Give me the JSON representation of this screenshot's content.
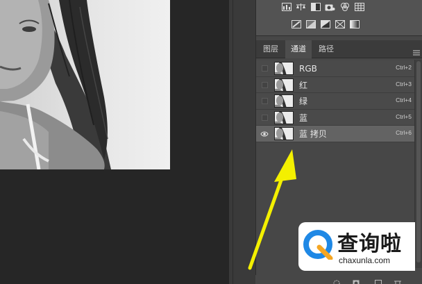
{
  "tabs": [
    {
      "label": "图层"
    },
    {
      "label": "通道"
    },
    {
      "label": "路径"
    }
  ],
  "active_tab": "通道",
  "channels": [
    {
      "name": "RGB",
      "shortcut": "Ctrl+2",
      "visible": false,
      "selected": false
    },
    {
      "name": "红",
      "shortcut": "Ctrl+3",
      "visible": false,
      "selected": false
    },
    {
      "name": "绿",
      "shortcut": "Ctrl+4",
      "visible": false,
      "selected": false
    },
    {
      "name": "蓝",
      "shortcut": "Ctrl+5",
      "visible": false,
      "selected": false
    },
    {
      "name": "蓝 拷贝",
      "shortcut": "Ctrl+6",
      "visible": true,
      "selected": true
    }
  ],
  "adjustment_icons_row1": [
    "levels-icon",
    "balance-icon",
    "black-white-icon",
    "photo-filter-icon",
    "channel-mixer-icon",
    "color-lookup-icon"
  ],
  "adjustment_icons_row2": [
    "invert-icon",
    "posterize-icon",
    "threshold-icon",
    "selective-color-icon",
    "gradient-map-icon"
  ],
  "watermark": {
    "brand": "查询啦",
    "domain": "chaxunla.com"
  },
  "colors": {
    "panel_bg": "#474747",
    "selected_row": "#636363",
    "arrow": "#f4f000",
    "canvas_bg": "#262626"
  }
}
